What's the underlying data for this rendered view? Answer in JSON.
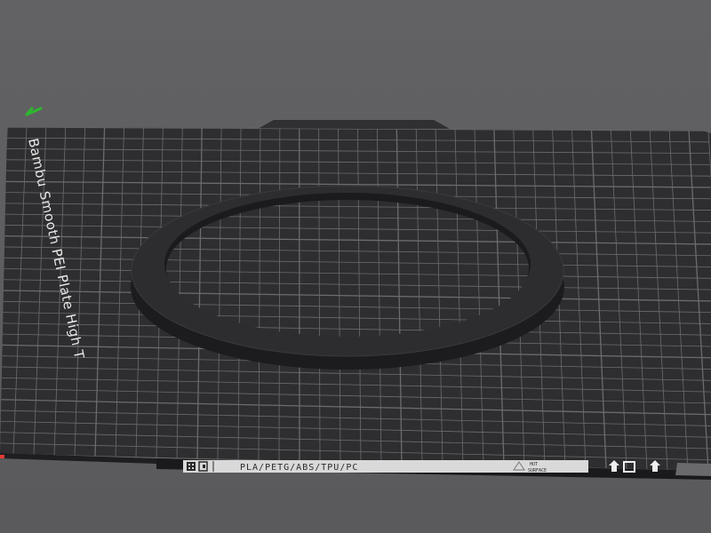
{
  "scene": {
    "plate_name": "Bambu Smooth PEI Plate High T",
    "filament_label": "PLA/PETG/ABS/TPU/PC",
    "surface_label_line1": "HOT",
    "surface_label_line2": "SURFACE",
    "object": "ring",
    "colors": {
      "background": "#5f5f61",
      "plate": "#2e2e30",
      "grid_line": "#6c6c70",
      "ring_top": "#2c2c2e",
      "ring_side": "#1c1c1e",
      "axis_x": "#e53935",
      "axis_y": "#2eb82e",
      "label_strip": "#d9d9d9"
    },
    "icons": [
      "y-axis-indicator-icon",
      "x-axis-indicator-icon",
      "plate-logo-icon",
      "bed-orientation-icon"
    ]
  }
}
